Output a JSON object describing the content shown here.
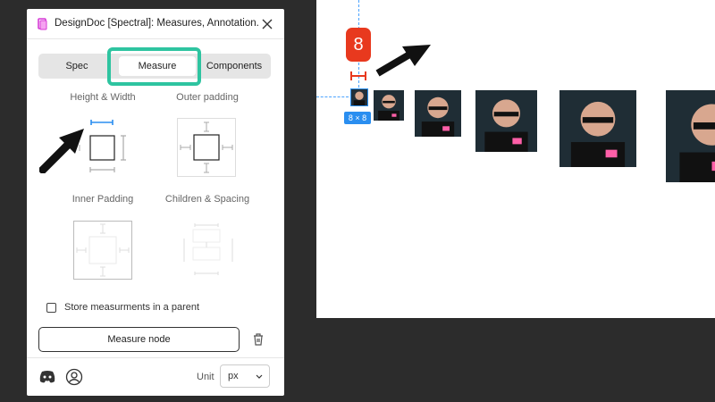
{
  "plugin": {
    "title": "DesignDoc [Spectral]: Measures, Annotation...",
    "tabs": [
      {
        "label": "Spec"
      },
      {
        "label": "Measure",
        "active": true
      },
      {
        "label": "Components"
      }
    ],
    "sections": {
      "height_width": "Height & Width",
      "outer_padding": "Outer padding",
      "inner_padding": "Inner Padding",
      "children_spacing": "Children & Spacing"
    },
    "store_checkbox": {
      "label": "Store measurments in a parent",
      "checked": false
    },
    "measure_button": "Measure node",
    "unit": {
      "label": "Unit",
      "value": "px"
    }
  },
  "canvas": {
    "badge_value": "8",
    "size_badge": "8 × 8"
  },
  "colors": {
    "accent_teal": "#2ec4a0",
    "badge_red": "#e8391e",
    "selection_blue": "#2a8ef0"
  },
  "icons": [
    "app-icon",
    "close-icon",
    "trash-icon",
    "discord-icon",
    "user-icon",
    "chevron-down-icon",
    "arrow-icon"
  ]
}
